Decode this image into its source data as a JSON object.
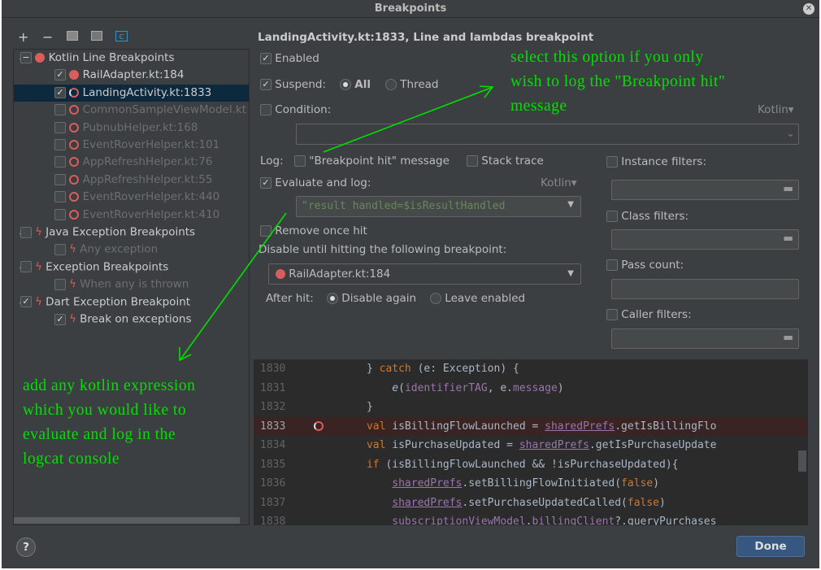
{
  "window": {
    "title": "Breakpoints"
  },
  "toolbar": {
    "add": "+",
    "remove": "−"
  },
  "tree": [
    {
      "label": "Kotlin Line Breakpoints",
      "level": 0,
      "check": "partial",
      "icon": "dot",
      "expanded": true
    },
    {
      "label": "RailAdapter.kt:184",
      "level": 1,
      "check": "on",
      "icon": "dot"
    },
    {
      "label": "LandingActivity.kt:1833",
      "level": 1,
      "check": "on",
      "icon": "log",
      "selected": true
    },
    {
      "label": "CommonSampleViewModel.kt",
      "level": 1,
      "check": "off",
      "icon": "ring",
      "disabled": true
    },
    {
      "label": "PubnubHelper.kt:168",
      "level": 1,
      "check": "off",
      "icon": "ring",
      "disabled": true
    },
    {
      "label": "EventRoverHelper.kt:101",
      "level": 1,
      "check": "off",
      "icon": "ring",
      "disabled": true
    },
    {
      "label": "AppRefreshHelper.kt:76",
      "level": 1,
      "check": "off",
      "icon": "ring",
      "disabled": true
    },
    {
      "label": "AppRefreshHelper.kt:55",
      "level": 1,
      "check": "off",
      "icon": "ring",
      "disabled": true
    },
    {
      "label": "EventRoverHelper.kt:440",
      "level": 1,
      "check": "off",
      "icon": "ring",
      "disabled": true
    },
    {
      "label": "EventRoverHelper.kt:410",
      "level": 1,
      "check": "off",
      "icon": "ring",
      "disabled": true
    },
    {
      "label": "Java Exception Breakpoints",
      "level": 0,
      "check": "off",
      "icon": "bolt",
      "expanded": true
    },
    {
      "label": "Any exception",
      "level": 1,
      "check": "off",
      "icon": "bolt",
      "disabled": true
    },
    {
      "label": "Exception Breakpoints",
      "level": 0,
      "check": "off",
      "icon": "bolt",
      "expanded": true
    },
    {
      "label": "When any is thrown",
      "level": 1,
      "check": "off",
      "icon": "bolt",
      "disabled": true
    },
    {
      "label": "Dart Exception Breakpoint",
      "level": 0,
      "check": "on",
      "icon": "bolt",
      "expanded": true
    },
    {
      "label": "Break on exceptions",
      "level": 1,
      "check": "on",
      "icon": "bolt"
    }
  ],
  "details": {
    "heading": "LandingActivity.kt:1833, Line and lambdas breakpoint",
    "enabled": "Enabled",
    "suspend": "Suspend:",
    "all": "All",
    "thread": "Thread",
    "condition": "Condition:",
    "lang": "Kotlin",
    "log": "Log:",
    "log_msg": "\"Breakpoint hit\" message",
    "stack": "Stack trace",
    "eval": "Evaluate and log:",
    "eval_value": "\"result handled=$isResultHandled",
    "remove_once": "Remove once hit",
    "disable_until": "Disable until hitting the following breakpoint:",
    "dep_bp": "RailAdapter.kt:184",
    "after_hit": "After hit:",
    "disable_again": "Disable again",
    "leave_enabled": "Leave enabled",
    "instance": "Instance filters:",
    "class": "Class filters:",
    "pass": "Pass count:",
    "caller": "Caller filters:"
  },
  "code": [
    {
      "n": "1830",
      "t": [
        [
          "      } ",
          ""
        ],
        [
          "catch",
          "kw"
        ],
        [
          " (e: Exception) {",
          ""
        ]
      ]
    },
    {
      "n": "1831",
      "t": [
        [
          "          ",
          ""
        ],
        [
          "e",
          "it"
        ],
        [
          "(",
          ""
        ],
        [
          "identifierTAG",
          "pu"
        ],
        [
          ", e.",
          ""
        ],
        [
          "message",
          "pu"
        ],
        [
          ")",
          ""
        ]
      ]
    },
    {
      "n": "1832",
      "t": [
        [
          "      }",
          ""
        ]
      ]
    },
    {
      "n": "1833",
      "t": [
        [
          "      ",
          ""
        ],
        [
          "val",
          "kw"
        ],
        [
          " isBillingFlowLaunched = ",
          ""
        ],
        [
          "sharedPrefs",
          "un"
        ],
        [
          ".getIsBillingFlo",
          ""
        ]
      ],
      "bp": true
    },
    {
      "n": "1834",
      "t": [
        [
          "      ",
          ""
        ],
        [
          "val",
          "kw"
        ],
        [
          " isPurchaseUpdated = ",
          ""
        ],
        [
          "sharedPrefs",
          "un"
        ],
        [
          ".getIsPurchaseUpdate",
          ""
        ]
      ]
    },
    {
      "n": "1835",
      "t": [
        [
          "      ",
          ""
        ],
        [
          "if",
          "kw"
        ],
        [
          " (isBillingFlowLaunched && !isPurchaseUpdated){",
          ""
        ]
      ]
    },
    {
      "n": "1836",
      "t": [
        [
          "          ",
          ""
        ],
        [
          "sharedPrefs",
          "un"
        ],
        [
          ".setBillingFlowInitiated(",
          ""
        ],
        [
          "false",
          "kw"
        ],
        [
          ")",
          ""
        ]
      ]
    },
    {
      "n": "1837",
      "t": [
        [
          "          ",
          ""
        ],
        [
          "sharedPrefs",
          "un"
        ],
        [
          ".setPurchaseUpdatedCalled(",
          ""
        ],
        [
          "false",
          "kw"
        ],
        [
          ")",
          ""
        ]
      ]
    },
    {
      "n": "1838",
      "t": [
        [
          "          ",
          ""
        ],
        [
          "subscriptionViewModel",
          "pu"
        ],
        [
          ".",
          ""
        ],
        [
          "billingClient",
          "pu"
        ],
        [
          "?.queryPurchases",
          ""
        ]
      ]
    }
  ],
  "annotations": {
    "top": [
      "select this option if you only",
      "wish to log the \"Breakpoint hit\"",
      "message"
    ],
    "left": [
      "add any kotlin expression",
      "which you would like to",
      "evaluate and log in the",
      "logcat console"
    ]
  },
  "buttons": {
    "done": "Done",
    "help": "?"
  },
  "colors": {
    "accent": "#365880",
    "annotation": "#00e000",
    "breakpoint": "#db5c5c"
  }
}
